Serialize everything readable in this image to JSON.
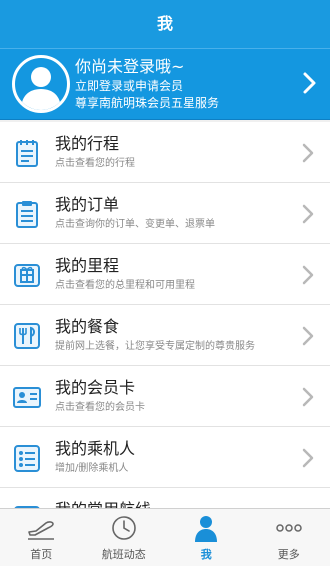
{
  "header": {
    "title": "我"
  },
  "profile": {
    "title": "你尚未登录哦~",
    "line1": "立即登录或申请会员",
    "line2": "尊享南航明珠会员五星服务"
  },
  "colors": {
    "primary": "#1a9ae0",
    "icon_blue": "#2a8fd6",
    "chevron": "#b8b8b8"
  },
  "menu": [
    {
      "title": "我的行程",
      "subtitle": "点击查看您的行程",
      "icon": "notepad-icon"
    },
    {
      "title": "我的订单",
      "subtitle": "点击查询你的订单、变更单、退票单",
      "icon": "clipboard-icon"
    },
    {
      "title": "我的里程",
      "subtitle": "点击查看您的总里程和可用里程",
      "icon": "gift-icon"
    },
    {
      "title": "我的餐食",
      "subtitle": "提前网上选餐，让您享受专属定制的尊贵服务",
      "icon": "cutlery-icon"
    },
    {
      "title": "我的会员卡",
      "subtitle": "点击查看您的会员卡",
      "icon": "member-card-icon"
    },
    {
      "title": "我的乘机人",
      "subtitle": "增加/删除乘机人",
      "icon": "passenger-list-icon"
    },
    {
      "title": "我的常用航线",
      "subtitle": "",
      "icon": "route-icon"
    }
  ],
  "tabs": [
    {
      "label": "首页",
      "icon": "plane-takeoff-icon"
    },
    {
      "label": "航班动态",
      "icon": "clock-icon"
    },
    {
      "label": "我",
      "icon": "person-icon",
      "active": true
    },
    {
      "label": "更多",
      "icon": "more-dots-icon"
    }
  ]
}
